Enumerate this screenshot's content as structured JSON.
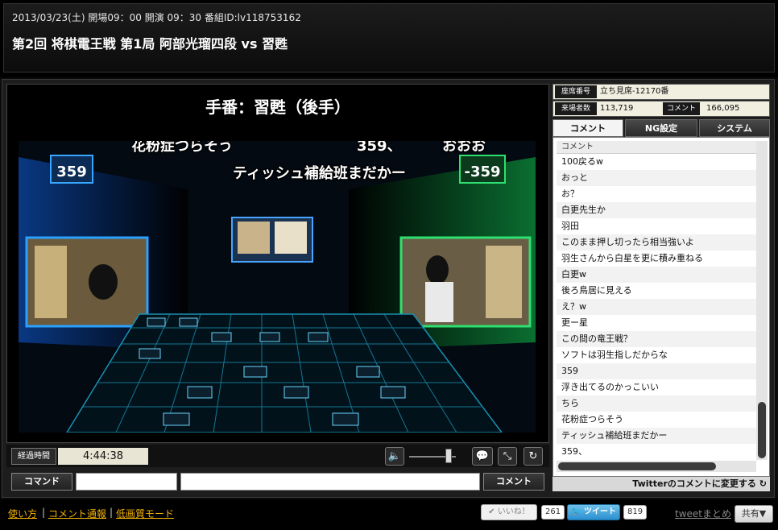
{
  "header": {
    "meta": "2013/03/23(土) 開場09：00 開演 09：30 番組ID:lv118753162",
    "title": "第2回 将棋電王戦 第1局 阿部光瑠四段 vs 習甦"
  },
  "player": {
    "turn_text": "手番：習甦（後手）",
    "danmaku": [
      "花粉症つらそう",
      "359、",
      "おおお",
      "ティッシュ補給班まだかー"
    ],
    "elapsed_label": "経過時間",
    "elapsed_value": "4:44:38",
    "volume_level": 0.9,
    "command_label": "コマンド",
    "comment_send_label": "コメント"
  },
  "side": {
    "seat_label": "座席番号",
    "seat_value": "立ち見席-12170番",
    "visitors_label": "来場者数",
    "visitors_value": "113,719",
    "comments_label": "コメント",
    "comments_value": "166,095",
    "tabs": [
      "コメント",
      "NG設定",
      "システム"
    ],
    "comment_header": "コメント",
    "comments": [
      "100戻るw",
      "おっと",
      "お？",
      "白更先生か",
      "羽田",
      "このまま押し切ったら相当強いよ",
      "羽生さんから白星を更に積み重ねる",
      "白更w",
      "後ろ鳥居に見える",
      "え？w",
      "更ー星",
      "この間の竜王戦？",
      "ソフトは羽生指しだからな",
      "359",
      "浮き出てるのかっこいい",
      "ちら",
      "花粉症つらそう",
      "ティッシュ補給班まだかー",
      "359、"
    ],
    "twitter_toggle": "Twitterのコメントに変更する"
  },
  "footer": {
    "links": [
      "使い方",
      "コメント通報",
      "低画質モード"
    ],
    "like_label": "いいね！",
    "like_count": "261",
    "tweet_label": "ツイート",
    "tweet_count": "819",
    "tweet_matome": "tweetまとめ",
    "share_label": "共有▼"
  },
  "colors": {
    "accent_link": "#f0b000",
    "video_green": "#1ee07a",
    "video_blue": "#1e9bff"
  }
}
